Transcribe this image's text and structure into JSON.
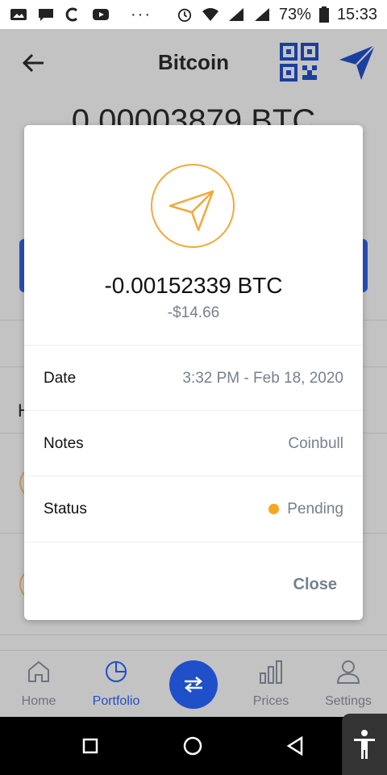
{
  "status_bar": {
    "battery": "73%",
    "time": "15:33",
    "icons": [
      "photo-icon",
      "message-icon",
      "c-icon",
      "youtube-icon",
      "more-dots-icon",
      "alarm-icon",
      "wifi-icon",
      "signal-icon",
      "battery-icon"
    ]
  },
  "header": {
    "title": "Bitcoin",
    "icons": [
      "back-arrow-icon",
      "qr-code-icon",
      "send-icon"
    ]
  },
  "background": {
    "balance": "0.00003879 BTC",
    "partial_heading": "H"
  },
  "modal": {
    "amount": "-0.00152339 BTC",
    "fiat": "-$14.66",
    "icon": "send-icon",
    "rows": [
      {
        "key": "Date",
        "value": "3:32 PM - Feb 18, 2020"
      },
      {
        "key": "Notes",
        "value": "Coinbull"
      },
      {
        "key": "Status",
        "value": "Pending"
      }
    ],
    "close_label": "Close",
    "accent_color": "#f0a93b",
    "pending_color": "#f5a623"
  },
  "bottom_nav": {
    "items": [
      {
        "label": "Home",
        "icon": "home-icon"
      },
      {
        "label": "Portfolio",
        "icon": "pie-chart-icon",
        "active": true
      },
      {
        "label": "Prices",
        "icon": "bar-chart-icon"
      },
      {
        "label": "Settings",
        "icon": "user-icon"
      }
    ],
    "trade_icon": "swap-arrows-icon",
    "active_color": "#1f4fc9"
  },
  "system_nav": {
    "icons": [
      "recents-icon",
      "home-circle-icon",
      "back-triangle-icon",
      "accessibility-icon"
    ]
  }
}
